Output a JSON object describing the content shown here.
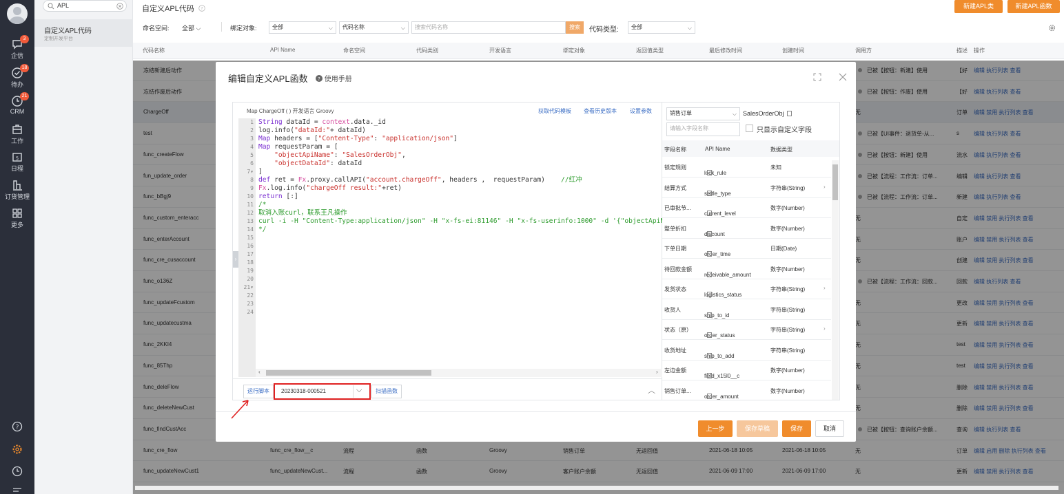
{
  "nav": {
    "items": [
      {
        "label": "企信",
        "badge": "3"
      },
      {
        "label": "待办",
        "badge": "18"
      },
      {
        "label": "CRM",
        "badge": "21"
      },
      {
        "label": "工作",
        "badge": ""
      },
      {
        "label": "日程",
        "badge": ""
      },
      {
        "label": "订货管理",
        "badge": ""
      },
      {
        "label": "更多",
        "badge": ""
      }
    ]
  },
  "search": {
    "value": "APL"
  },
  "subnav": {
    "title": "自定义APL代码",
    "subtitle": "定制开发平台"
  },
  "header": {
    "title": "自定义APL代码",
    "btn_new_class": "新建APL类",
    "btn_new_func": "新建APL函数"
  },
  "filters": {
    "namespace_label": "命名空间:",
    "namespace_value": "全部",
    "bind_label": "绑定对象:",
    "bind_value": "全部",
    "code_name_select": "代码名称",
    "code_search_placeholder": "搜索代码名称",
    "search_btn": "搜索",
    "code_type_label": "代码类型:",
    "code_type_value": "全部"
  },
  "table": {
    "headers": [
      "代码名称",
      "API Name",
      "命名空间",
      "代码类别",
      "开发语言",
      "绑定对象",
      "返回值类型",
      "最后修改时间",
      "创建时间",
      "调用方",
      "描述",
      "操作"
    ],
    "rows": [
      {
        "name": "冻结新建后动作",
        "caller": "已被【按钮：新建】使用",
        "desc": "【好",
        "ops": "编辑 执行列表 查看",
        "dot": true
      },
      {
        "name": "冻结作废后动作",
        "caller": "已被【按钮：作废】使用",
        "desc": "【好",
        "ops": "编辑 执行列表 查看",
        "dot": true
      },
      {
        "name": "ChargeOff",
        "caller": "无",
        "desc": "订单",
        "ops": "编辑 禁用 执行列表 查看",
        "dot": false
      },
      {
        "name": "test",
        "caller": "已被【UI事件：退货单-从...",
        "desc": "s",
        "ops": "编辑 执行列表 查看",
        "dot": true
      },
      {
        "name": "func_createFlow",
        "caller": "已被【按钮：新建】使用",
        "desc": "流水",
        "ops": "编辑 执行列表 查看",
        "dot": true
      },
      {
        "name": "fun_update_order",
        "caller": "已被【流程：工作流：订单...",
        "desc": "编辑",
        "ops": "编辑 执行列表 查看",
        "dot": true
      },
      {
        "name": "func_bBgj9",
        "caller": "已被【流程：工作流：订单...",
        "desc": "新建",
        "ops": "编辑 执行列表 查看",
        "dot": true
      },
      {
        "name": "func_custom_enteracc",
        "caller": "无",
        "desc": "自定",
        "ops": "编辑 禁用 执行列表 查看",
        "dot": false
      },
      {
        "name": "func_enterAccount",
        "caller": "无",
        "desc": "账户",
        "ops": "编辑 禁用 执行列表 查看",
        "dot": false
      },
      {
        "name": "func_cre_cusaccount",
        "caller": "无",
        "desc": "创建",
        "ops": "编辑 禁用 执行列表 查看",
        "dot": false
      },
      {
        "name": "func_o136Z",
        "caller": "已被【流程：工作流：回款...",
        "desc": "回款",
        "ops": "编辑 执行列表 查看",
        "dot": true
      },
      {
        "name": "func_updateFcustom",
        "caller": "无",
        "desc": "更改",
        "ops": "编辑 禁用 执行列表 查看",
        "dot": false
      },
      {
        "name": "func_updatecustma",
        "caller": "无",
        "desc": "更新",
        "ops": "编辑 禁用 执行列表 查看",
        "dot": false
      },
      {
        "name": "func_2KKI4",
        "caller": "无",
        "desc": "test",
        "ops": "编辑 禁用 执行列表 查看",
        "dot": false
      },
      {
        "name": "func_85Thp",
        "caller": "无",
        "desc": "test",
        "ops": "编辑 禁用 执行列表 查看",
        "dot": false
      },
      {
        "name": "func_deleFlow",
        "caller": "无",
        "desc": "删除",
        "ops": "编辑 禁用 执行列表 查看",
        "dot": false
      },
      {
        "name": "func_deleteNewCust",
        "caller": "无",
        "desc": "删除",
        "ops": "编辑 禁用 执行列表 查看",
        "dot": false
      },
      {
        "name": "func_findCustAcc",
        "caller": "已被【按钮：查询账户余额...",
        "desc": "查询",
        "ops": "编辑 执行列表 查看",
        "dot": true
      }
    ],
    "bottom_rows": [
      {
        "name": "func_cre_flow",
        "api": "func_cre_flow__c",
        "ns": "流程",
        "cat": "函数",
        "lang": "Groovy",
        "obj": "销售订单",
        "ret": "无返回值",
        "mod": "2021-06-18 10:05",
        "created": "2021-06-18 10:05",
        "caller": "无",
        "desc": "订单",
        "ops": "编辑 启用 删除 执行列表 查看"
      },
      {
        "name": "func_updateNewCust1",
        "api": "func_updateNewCust...",
        "ns": "流程",
        "cat": "函数",
        "lang": "Groovy",
        "obj": "客户账户余额",
        "ret": "无返回值",
        "mod": "2021-06-09 17:00",
        "created": "2021-06-09 17:00",
        "caller": "无",
        "desc": "更新",
        "ops": "编辑 禁用 执行列表 查看"
      }
    ]
  },
  "modal": {
    "title": "编辑自定义APL函数",
    "help": "使用手册",
    "editor_info": "Map ChargeOff ( )   开发语言 Groovy",
    "link_template": "获取代码模板",
    "link_history": "查看历史版本",
    "link_params": "设置参数",
    "code_lines": [
      "",
      "String dataId = context.data._id",
      "log.info(\"dataId:\"+ dataId)",
      "",
      "Map headers = [\"Content-Type\": \"application/json\"]",
      "",
      "Map requestParam = [",
      "    \"objectApiName\": \"SalesOrderObj\",",
      "    \"objectDataId\": dataId",
      "]",
      "",
      "def ret = Fx.proxy.callAPI(\"account.chargeOff\", headers ,  requestParam)    //红冲",
      "Fx.log.info(\"chargeOff result:\"+ret)",
      "return [:]",
      "",
      "",
      "",
      "",
      "",
      "",
      "/*",
      "取消入账curl，联系王凡操作",
      "curl -i -H \"Content-Type:application/json\" -H \"x-fs-ei:81146\" -H \"x-fs-userinfo:1000\" -d '{\"objectApiName",
      "*/"
    ],
    "run_btn": "运行脚本",
    "run_data_value": "20230318-000521",
    "scan_btn": "扫描函数",
    "object_select": "销售订单",
    "object_api": "SalesOrderObj",
    "field_search_placeholder": "请输入字段名称",
    "only_custom_label": "只显示自定义字段",
    "field_headers": [
      "字段名称",
      "API Name",
      "数据类型"
    ],
    "fields": [
      {
        "name": "锁定规则",
        "api": "lock_rule",
        "type": "未知",
        "arrow": false
      },
      {
        "name": "结算方式",
        "api": "settle_type",
        "type": "字符串(String)",
        "arrow": true
      },
      {
        "name": "已审批节...",
        "api": "current_level",
        "type": "数字(Number)",
        "arrow": false
      },
      {
        "name": "整单折扣",
        "api": "discount",
        "type": "数字(Number)",
        "arrow": false
      },
      {
        "name": "下单日期",
        "api": "order_time",
        "type": "日期(Date)",
        "arrow": false
      },
      {
        "name": "待回款金额",
        "api": "receivable_amount",
        "type": "数字(Number)",
        "arrow": false
      },
      {
        "name": "发货状态",
        "api": "logistics_status",
        "type": "字符串(String)",
        "arrow": true
      },
      {
        "name": "收货人",
        "api": "ship_to_id",
        "type": "字符串(String)",
        "arrow": false
      },
      {
        "name": "状态（原）",
        "api": "order_status",
        "type": "字符串(String)",
        "arrow": true
      },
      {
        "name": "收货地址",
        "api": "ship_to_add",
        "type": "字符串(String)",
        "arrow": false
      },
      {
        "name": "左边金额",
        "api": "field_x15l0__c",
        "type": "数字(Number)",
        "arrow": false
      },
      {
        "name": "销售订单...",
        "api": "order_amount",
        "type": "数字(Number)",
        "arrow": false
      }
    ],
    "btn_prev": "上一步",
    "btn_save_draft": "保存草稿",
    "btn_save": "保存",
    "btn_cancel": "取消"
  }
}
